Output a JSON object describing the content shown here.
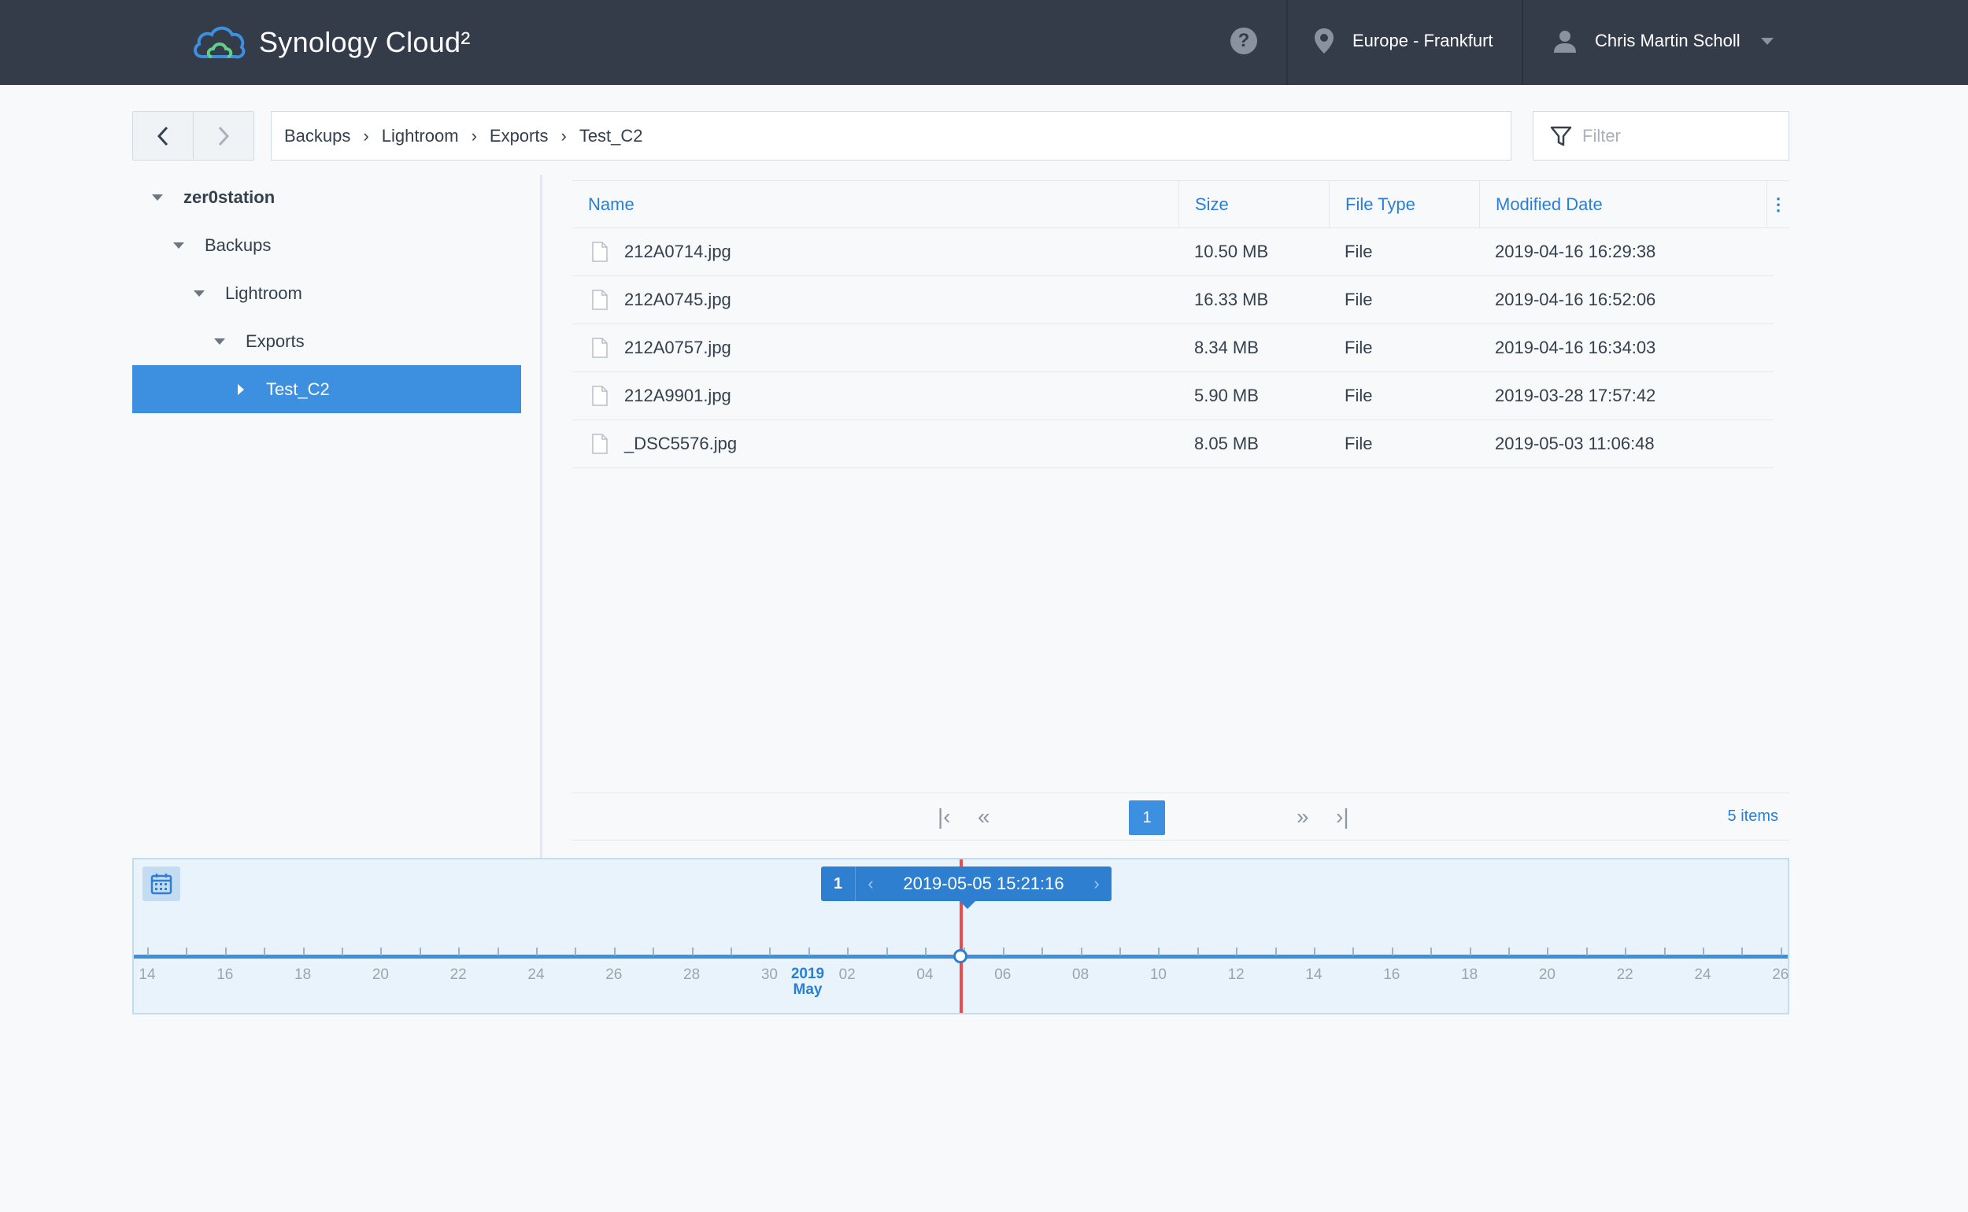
{
  "header": {
    "app_title": "Synology Cloud²",
    "help_label": "?",
    "region": "Europe - Frankfurt",
    "user": "Chris Martin Scholl"
  },
  "toolbar": {
    "back_icon": "chevron-left-icon",
    "forward_icon": "chevron-right-icon",
    "breadcrumb": [
      "Backups",
      "Lightroom",
      "Exports",
      "Test_C2"
    ],
    "filter_placeholder": "Filter"
  },
  "tree": [
    {
      "label": "zer0station",
      "level": 0,
      "expanded": true,
      "selected": false
    },
    {
      "label": "Backups",
      "level": 1,
      "expanded": true,
      "selected": false
    },
    {
      "label": "Lightroom",
      "level": 2,
      "expanded": true,
      "selected": false
    },
    {
      "label": "Exports",
      "level": 3,
      "expanded": true,
      "selected": false
    },
    {
      "label": "Test_C2",
      "level": 4,
      "expanded": false,
      "selected": true
    }
  ],
  "table": {
    "columns": {
      "name": "Name",
      "size": "Size",
      "type": "File Type",
      "date": "Modified Date"
    },
    "rows": [
      {
        "name": "212A0714.jpg",
        "size": "10.50 MB",
        "type": "File",
        "date": "2019-04-16 16:29:38"
      },
      {
        "name": "212A0745.jpg",
        "size": "16.33 MB",
        "type": "File",
        "date": "2019-04-16 16:52:06"
      },
      {
        "name": "212A0757.jpg",
        "size": "8.34 MB",
        "type": "File",
        "date": "2019-04-16 16:34:03"
      },
      {
        "name": "212A9901.jpg",
        "size": "5.90 MB",
        "type": "File",
        "date": "2019-03-28 17:57:42"
      },
      {
        "name": "_DSC5576.jpg",
        "size": "8.05 MB",
        "type": "File",
        "date": "2019-05-03 11:06:48"
      }
    ]
  },
  "pager": {
    "current_page": "1",
    "item_count": "5 items"
  },
  "timeline": {
    "version_count": "1",
    "selected_time": "2019-05-05 15:21:16",
    "year_label": "2019",
    "month_label": "May",
    "day_labels": [
      "14",
      "16",
      "18",
      "20",
      "22",
      "24",
      "26",
      "28",
      "30",
      "02",
      "04",
      "06",
      "08",
      "10",
      "12",
      "14",
      "16",
      "18",
      "20",
      "22",
      "24",
      "26"
    ]
  },
  "colors": {
    "header_bg": "#343c49",
    "accent": "#3d8fe0",
    "link": "#2a7fd4",
    "timeline_bg": "#e8f3fc",
    "cursor": "#e84c4c"
  }
}
